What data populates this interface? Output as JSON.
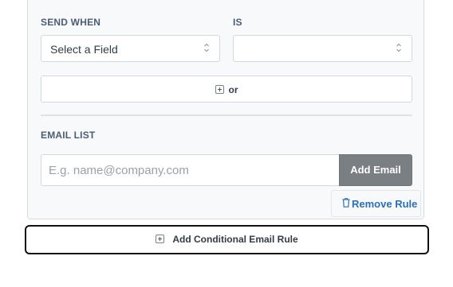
{
  "rule": {
    "send_when_label": "SEND WHEN",
    "is_label": "IS",
    "field_select": {
      "value": "Select a Field"
    },
    "value_select": {
      "value": ""
    },
    "or_button_label": "or",
    "email_list_label": "EMAIL LIST",
    "email_input": {
      "placeholder": "E.g. name@company.com",
      "value": ""
    },
    "add_email_label": "Add Email",
    "remove_rule_label": "Remove Rule"
  },
  "add_rule_button_label": "Add Conditional Email Rule",
  "icons": {
    "select_caret": "up-down-caret-icon",
    "plus": "plus-box-icon",
    "trash": "trash-icon"
  },
  "colors": {
    "link": "#2c6fb3",
    "add_email_bg": "#7a7f84",
    "label": "#4b5d72"
  }
}
